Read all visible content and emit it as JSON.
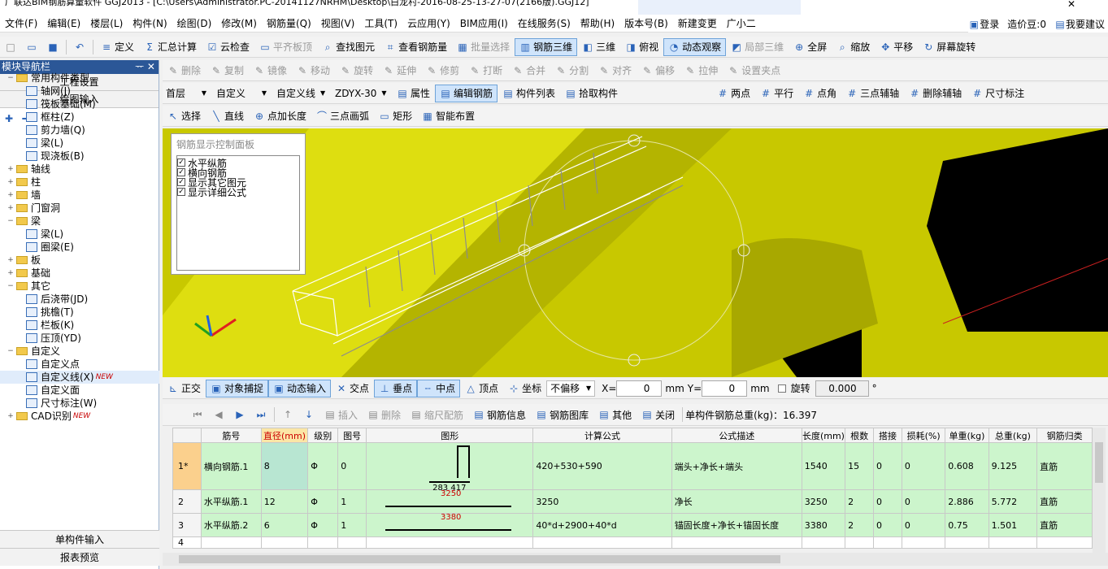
{
  "title": "广联达BIM钢筋算量软件 GGJ2013 - [C:\\Users\\Administrator.PC-20141127NRHM\\Desktop\\白龙村-2016-08-25-13-27-07(2166版).GGJ12]",
  "menu": [
    "文件(F)",
    "编辑(E)",
    "楼层(L)",
    "构件(N)",
    "绘图(D)",
    "修改(M)",
    "钢筋量(Q)",
    "视图(V)",
    "工具(T)",
    "云应用(Y)",
    "BIM应用(I)",
    "在线服务(S)",
    "帮助(H)",
    "版本号(B)",
    "新建变更",
    "广小二"
  ],
  "menu_right": {
    "login": "登录",
    "price_bean": "造价豆:0",
    "suggest": "我要建议"
  },
  "toolbar1": [
    "定义",
    "汇总计算",
    "云检查",
    "平齐板顶",
    "查找图元",
    "查看钢筋量",
    "批量选择",
    "钢筋三维",
    "三维",
    "俯视",
    "动态观察",
    "局部三维",
    "全屏",
    "缩放",
    "平移",
    "屏幕旋转"
  ],
  "toolbar2": [
    "删除",
    "复制",
    "镜像",
    "移动",
    "旋转",
    "延伸",
    "修剪",
    "打断",
    "合并",
    "分割",
    "对齐",
    "偏移",
    "拉伸",
    "设置夹点"
  ],
  "toolbar3": {
    "floor": "首层",
    "type": "自定义",
    "subtype": "自定义线",
    "element": "ZDYX-30",
    "buttons": [
      "属性",
      "编辑钢筋",
      "构件列表",
      "拾取构件"
    ],
    "aux": [
      "两点",
      "平行",
      "点角",
      "三点辅轴",
      "删除辅轴",
      "尺寸标注"
    ]
  },
  "toolbar4": [
    "选择",
    "直线",
    "点加长度",
    "三点画弧",
    "矩形",
    "智能布置"
  ],
  "nav": {
    "title": "模块导航栏",
    "btn1": "工程设置",
    "btn2": "绘图输入",
    "bottom1": "单构件输入",
    "bottom2": "报表预览",
    "tree": [
      {
        "lvl": 0,
        "kind": "folder",
        "exp": "−",
        "label": "常用构件类型"
      },
      {
        "lvl": 1,
        "kind": "leaf",
        "label": "轴网(J)"
      },
      {
        "lvl": 1,
        "kind": "leaf",
        "label": "筏板基础(M)"
      },
      {
        "lvl": 1,
        "kind": "leaf",
        "label": "框柱(Z)"
      },
      {
        "lvl": 1,
        "kind": "leaf",
        "label": "剪力墙(Q)"
      },
      {
        "lvl": 1,
        "kind": "leaf",
        "label": "梁(L)"
      },
      {
        "lvl": 1,
        "kind": "leaf",
        "label": "现浇板(B)"
      },
      {
        "lvl": 0,
        "kind": "folder",
        "exp": "+",
        "label": "轴线"
      },
      {
        "lvl": 0,
        "kind": "folder",
        "exp": "+",
        "label": "柱"
      },
      {
        "lvl": 0,
        "kind": "folder",
        "exp": "+",
        "label": "墙"
      },
      {
        "lvl": 0,
        "kind": "folder",
        "exp": "+",
        "label": "门窗洞"
      },
      {
        "lvl": 0,
        "kind": "folder",
        "exp": "−",
        "label": "梁"
      },
      {
        "lvl": 1,
        "kind": "leaf",
        "label": "梁(L)"
      },
      {
        "lvl": 1,
        "kind": "leaf",
        "label": "圈梁(E)"
      },
      {
        "lvl": 0,
        "kind": "folder",
        "exp": "+",
        "label": "板"
      },
      {
        "lvl": 0,
        "kind": "folder",
        "exp": "+",
        "label": "基础"
      },
      {
        "lvl": 0,
        "kind": "folder",
        "exp": "−",
        "label": "其它"
      },
      {
        "lvl": 1,
        "kind": "leaf",
        "label": "后浇带(JD)"
      },
      {
        "lvl": 1,
        "kind": "leaf",
        "label": "挑檐(T)"
      },
      {
        "lvl": 1,
        "kind": "leaf",
        "label": "栏板(K)"
      },
      {
        "lvl": 1,
        "kind": "leaf",
        "label": "压顶(YD)"
      },
      {
        "lvl": 0,
        "kind": "folder",
        "exp": "−",
        "label": "自定义"
      },
      {
        "lvl": 1,
        "kind": "leaf",
        "label": "自定义点"
      },
      {
        "lvl": 1,
        "kind": "leaf",
        "label": "自定义线(X)",
        "new": "NEW"
      },
      {
        "lvl": 1,
        "kind": "leaf",
        "label": "自定义面"
      },
      {
        "lvl": 1,
        "kind": "leaf",
        "label": "尺寸标注(W)"
      },
      {
        "lvl": 0,
        "kind": "folder",
        "exp": "+",
        "label": "CAD识别",
        "new": "NEW"
      }
    ]
  },
  "panel": {
    "title": "钢筋显示控制面板",
    "items": [
      "水平纵筋",
      "横向钢筋",
      "显示其它图元",
      "显示详细公式"
    ]
  },
  "statusbar": {
    "buttons": [
      "正交",
      "对象捕捉",
      "动态输入",
      "交点",
      "垂点",
      "中点",
      "顶点",
      "坐标"
    ],
    "offset": "不偏移",
    "x_label": "X=",
    "x": "0",
    "mm1": "mm",
    "y_label": "Y=",
    "y": "0",
    "mm2": "mm",
    "rotate_label": "旋转",
    "rotate": "0.000",
    "deg": "°"
  },
  "rebar_toolbar": {
    "buttons": [
      "插入",
      "删除",
      "缩尺配筋",
      "钢筋信息",
      "钢筋图库",
      "其他",
      "关闭"
    ],
    "total": "单构件钢筋总重(kg)：16.397"
  },
  "grid": {
    "columns": [
      "筋号",
      "直径(mm)",
      "级别",
      "图号",
      "图形",
      "计算公式",
      "公式描述",
      "长度(mm)",
      "根数",
      "搭接",
      "损耗(%)",
      "单重(kg)",
      "总重(kg)",
      "钢筋归类"
    ],
    "rows": [
      {
        "rn": "1*",
        "name": "横向钢筋.1",
        "dia": "8",
        "grade": "Φ",
        "fig": "0",
        "shape": "283 417",
        "formula": "420+530+590",
        "desc": "端头+净长+端头",
        "len": "1540",
        "count": "15",
        "lap": "0",
        "loss": "0",
        "unit": "0.608",
        "total": "9.125",
        "cls": "直筋"
      },
      {
        "rn": "2",
        "name": "水平纵筋.1",
        "dia": "12",
        "grade": "Φ",
        "fig": "1",
        "shape": "3250",
        "formula": "3250",
        "desc": "净长",
        "len": "3250",
        "count": "2",
        "lap": "0",
        "loss": "0",
        "unit": "2.886",
        "total": "5.772",
        "cls": "直筋"
      },
      {
        "rn": "3",
        "name": "水平纵筋.2",
        "dia": "6",
        "grade": "Φ",
        "fig": "1",
        "shape": "3380",
        "formula": "40*d+2900+40*d",
        "desc": "锚固长度+净长+锚固长度",
        "len": "3380",
        "count": "2",
        "lap": "0",
        "loss": "0",
        "unit": "0.75",
        "total": "1.501",
        "cls": "直筋"
      },
      {
        "rn": "4",
        "name": "",
        "dia": "",
        "grade": "",
        "fig": "",
        "shape": "",
        "formula": "",
        "desc": "",
        "len": "",
        "count": "",
        "lap": "",
        "loss": "",
        "unit": "",
        "total": "",
        "cls": ""
      }
    ]
  }
}
